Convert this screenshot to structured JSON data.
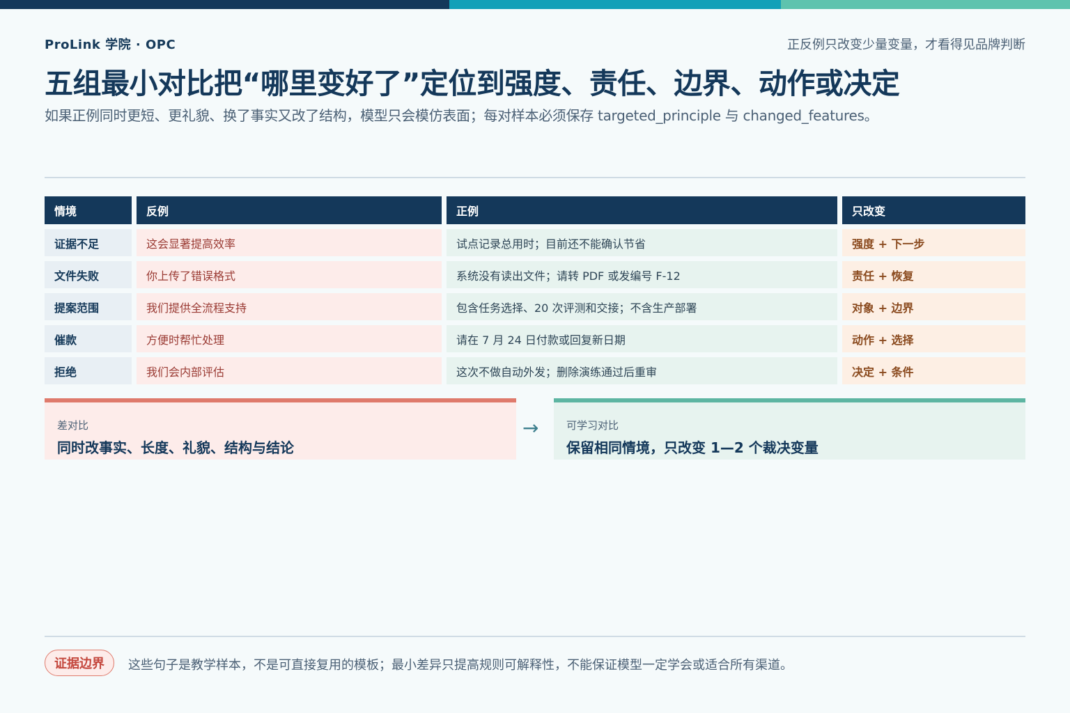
{
  "colors": {
    "bar_navy": "#14385a",
    "bar_teal": "#13a0b8",
    "bar_mint": "#5ec3ae"
  },
  "header": {
    "brand": "ProLink 学院 · OPC",
    "tagline": "正反例只改变少量变量，才看得见品牌判断",
    "title": "五组最小对比把“哪里变好了”定位到强度、责任、边界、动作或决定",
    "subtitle": "如果正例同时更短、更礼貌、换了事实又改了结构，模型只会模仿表面；每对样本必须保存 targeted_principle 与 changed_features。"
  },
  "table": {
    "headers": [
      "情境",
      "反例",
      "正例",
      "只改变"
    ],
    "rows": [
      {
        "situation": "证据不足",
        "bad": "这会显著提高效率",
        "good": "试点记录总用时；目前还不能确认节省",
        "change": "强度 + 下一步"
      },
      {
        "situation": "文件失败",
        "bad": "你上传了错误格式",
        "good": "系统没有读出文件；请转 PDF 或发编号 F-12",
        "change": "责任 + 恢复"
      },
      {
        "situation": "提案范围",
        "bad": "我们提供全流程支持",
        "good": "包含任务选择、20 次评测和交接；不含生产部署",
        "change": "对象 + 边界"
      },
      {
        "situation": "催款",
        "bad": "方便时帮忙处理",
        "good": "请在 7 月 24 日付款或回复新日期",
        "change": "动作 + 选择"
      },
      {
        "situation": "拒绝",
        "bad": "我们会内部评估",
        "good": "这次不做自动外发；删除演练通过后重审",
        "change": "决定 + 条件"
      }
    ]
  },
  "compare": {
    "bad_label": "差对比",
    "bad_text": "同时改事实、长度、礼貌、结构与结论",
    "arrow": "→",
    "good_label": "可学习对比",
    "good_text": "保留相同情境，只改变 1—2 个裁决变量"
  },
  "footer": {
    "badge": "证据边界",
    "text": "这些句子是教学样本，不是可直接复用的模板；最小差异只提高规则可解释性，不能保证模型一定学会或适合所有渠道。"
  }
}
